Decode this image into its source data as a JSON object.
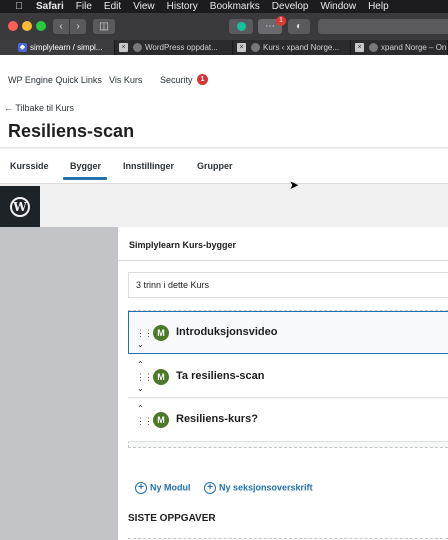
{
  "menubar": {
    "apple": "",
    "items": [
      "Safari",
      "File",
      "Edit",
      "View",
      "History",
      "Bookmarks",
      "Develop",
      "Window",
      "Help"
    ]
  },
  "toolbar": {
    "back": "‹",
    "forward": "›",
    "extension_badge": "1"
  },
  "tabs": [
    {
      "label": "simplylearn / simpl...",
      "active": true
    },
    {
      "label": "WordPress oppdat...",
      "active": false
    },
    {
      "label": "Kurs ‹ xpand Norge...",
      "active": false
    },
    {
      "label": "xpand Norge – Onli...",
      "active": false
    }
  ],
  "wp_quicklinks": {
    "wp_engine": "WP Engine Quick Links",
    "vis_kurs": "Vis Kurs",
    "security": "Security",
    "security_count": "1"
  },
  "header": {
    "back_link": "← Tilbake til Kurs",
    "title": "Resiliens-scan"
  },
  "course_tabs": [
    "Kursside",
    "Bygger",
    "Innstillinger",
    "Grupper"
  ],
  "active_tab": "Bygger",
  "builder": {
    "title": "Simplylearn Kurs-bygger",
    "steps": "3 trinn i dette Kurs",
    "modules": [
      {
        "badge": "M",
        "title": "Introduksjonsvideo"
      },
      {
        "badge": "M",
        "title": "Ta resiliens-scan"
      },
      {
        "badge": "M",
        "title": "Resiliens-kurs?"
      }
    ],
    "add_module": "Ny Modul",
    "add_section": "Ny seksjonsoverskrift",
    "siste": "SISTE OPPGAVER"
  },
  "colors": {
    "wp_dark": "#1d2327",
    "accent": "#2271b1",
    "module_badge": "#4d7a2a",
    "security_badge": "#d63638"
  }
}
